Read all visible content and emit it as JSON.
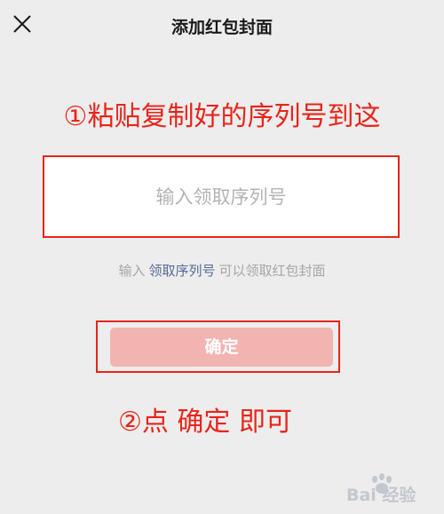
{
  "header": {
    "title": "添加红包封面",
    "close_icon": "close-icon"
  },
  "annotations": {
    "step1": "①粘贴复制好的序列号到这",
    "step2": "②点 确定 即可"
  },
  "form": {
    "code_placeholder": "输入领取序列号",
    "code_value": ""
  },
  "hint": {
    "prefix": "输入",
    "link": "领取序列号",
    "suffix": "可以领取红包封面"
  },
  "confirm_label": "确定",
  "watermark": {
    "text": "Bai 经验"
  },
  "colors": {
    "background": "#ededed",
    "annotation_red": "#e8241a",
    "link_blue": "#576b95",
    "button_disabled": "#f1b4b0"
  }
}
